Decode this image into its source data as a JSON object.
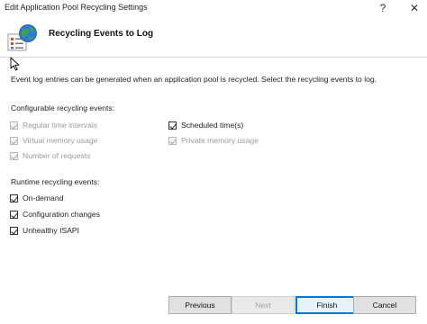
{
  "window": {
    "title": "Edit Application Pool Recycling Settings",
    "help_glyph": "?",
    "close_glyph": "✕"
  },
  "header": {
    "title": "Recycling Events to Log",
    "icon": "globe-with-list-icon"
  },
  "intro_text": "Event log entries can be generated when an application pool is recycled. Select the recycling events to log.",
  "configurable": {
    "label": "Configurable recycling events:",
    "items": [
      {
        "label": "Regular time intervals",
        "checked": true,
        "enabled": false
      },
      {
        "label": "Virtual memory usage",
        "checked": true,
        "enabled": false
      },
      {
        "label": "Number of requests",
        "checked": true,
        "enabled": false
      },
      {
        "label": "Scheduled time(s)",
        "checked": true,
        "enabled": true
      },
      {
        "label": "Private memory usage",
        "checked": true,
        "enabled": false
      }
    ]
  },
  "runtime": {
    "label": "Runtime recycling events:",
    "items": [
      {
        "label": "On-demand",
        "checked": true,
        "enabled": true
      },
      {
        "label": "Configuration changes",
        "checked": true,
        "enabled": true
      },
      {
        "label": "Unhealthy ISAPI",
        "checked": true,
        "enabled": true
      }
    ]
  },
  "buttons": {
    "previous": "Previous",
    "next": "Next",
    "finish": "Finish",
    "cancel": "Cancel"
  },
  "colors": {
    "accent": "#0078d7",
    "disabled_text": "#9a9a9a"
  }
}
